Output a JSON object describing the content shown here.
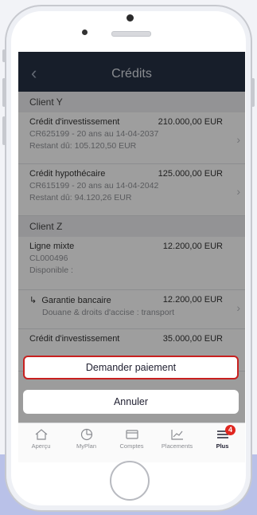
{
  "header": {
    "title": "Crédits",
    "back_icon": "chevron-left-icon"
  },
  "sections": [
    {
      "title": "Client Y",
      "items": [
        {
          "name": "Crédit d'investissement",
          "amount": "210.000,00 EUR",
          "line2": "CR625199 - 20 ans au 14-04-2037",
          "line3": "Restant dû: 105.120,50 EUR"
        },
        {
          "name": "Crédit hypothécaire",
          "amount": "125.000,00 EUR",
          "line2": "CR615199 - 20 ans au 14-04-2042",
          "line3": "Restant dû: 94.120,26 EUR"
        }
      ]
    },
    {
      "title": "Client Z",
      "items": [
        {
          "name": "Ligne mixte",
          "amount": "12.200,00 EUR",
          "line2": "CL000496",
          "line3": "Disponible :"
        },
        {
          "name": "Garantie bancaire",
          "amount": "12.200,00 EUR",
          "line2": "Douane & droits d'accise : transport"
        },
        {
          "name": "Crédit d'investissement",
          "amount": "35.000,00 EUR"
        }
      ]
    }
  ],
  "action_sheet": {
    "primary": "Demander paiement",
    "cancel": "Annuler"
  },
  "tabbar": [
    {
      "label": "Aperçu",
      "icon": "home-icon"
    },
    {
      "label": "MyPlan",
      "icon": "clock-icon"
    },
    {
      "label": "Comptes",
      "icon": "card-icon"
    },
    {
      "label": "Placements",
      "icon": "chart-icon"
    },
    {
      "label": "Plus",
      "icon": "menu-icon",
      "badge": "4"
    }
  ],
  "colors": {
    "navbar": "#252f43",
    "highlight": "#c8201f",
    "badge": "#e0261f"
  }
}
